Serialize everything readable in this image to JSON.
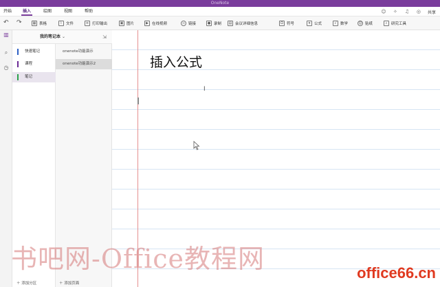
{
  "window": {
    "title": "OneNote"
  },
  "menu": {
    "tabs": [
      "开始",
      "插入",
      "绘图",
      "视图",
      "帮助"
    ],
    "active_tab": "插入",
    "share_label": "共享"
  },
  "ribbon": {
    "items": [
      "表格",
      "文件",
      "打印输出",
      "图片",
      "在线视频",
      "链接",
      "录制",
      "会议详细信息",
      "符号",
      "公式",
      "数学",
      "贴纸",
      "研究工具"
    ]
  },
  "notebook": {
    "name": "我的笔记本",
    "sections": [
      {
        "label": "快速笔记",
        "color": "#2d5fc4"
      },
      {
        "label": "课程",
        "color": "#6a2a94"
      },
      {
        "label": "笔记",
        "color": "#2aa24a"
      }
    ],
    "active_section": "笔记",
    "pages": [
      "onenote功能演示",
      "onenote功能演示2"
    ],
    "active_page": "onenote功能演示2",
    "add_section_label": "添加分区",
    "add_page_label": "添加页面"
  },
  "page": {
    "title": "插入公式"
  },
  "watermark": {
    "left": "书吧网-Office教程网",
    "right": "office66.cn"
  },
  "colors": {
    "accent": "#7a3c9c",
    "margin_line": "#e58f8f",
    "rule_line": "#d6e4f3"
  }
}
